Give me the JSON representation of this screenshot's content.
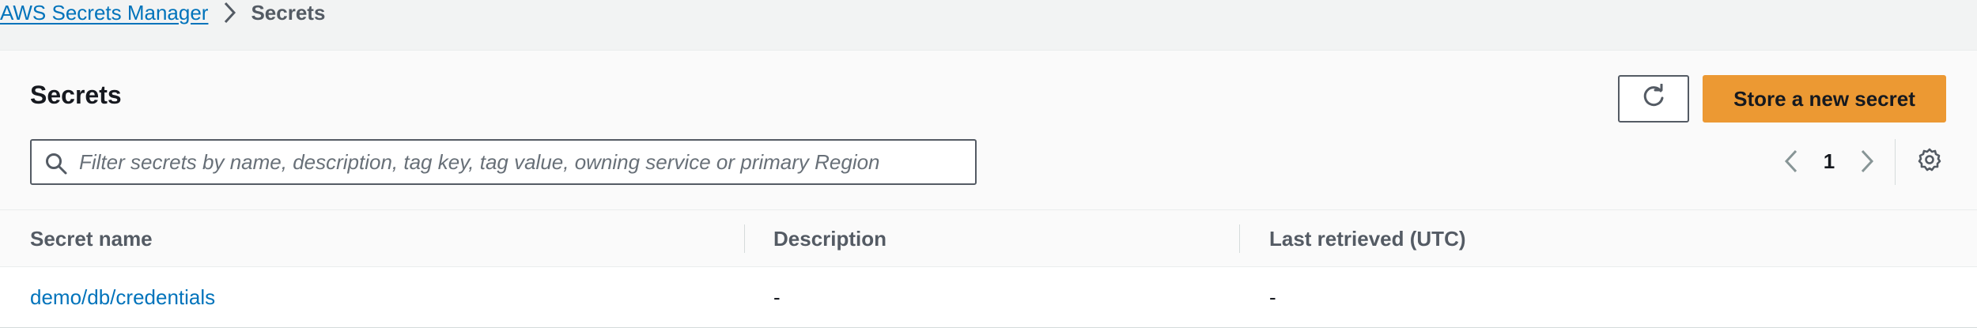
{
  "breadcrumb": {
    "root": "AWS Secrets Manager",
    "current": "Secrets"
  },
  "panel": {
    "title": "Secrets",
    "primary_button": "Store a new secret",
    "refresh_icon": "refresh-icon"
  },
  "search": {
    "placeholder": "Filter secrets by name, description, tag key, tag value, owning service or primary Region",
    "value": ""
  },
  "pagination": {
    "current_page": "1"
  },
  "table": {
    "columns": [
      "Secret name",
      "Description",
      "Last retrieved (UTC)"
    ],
    "rows": [
      {
        "name": "demo/db/credentials",
        "description": "-",
        "last_retrieved": "-"
      }
    ]
  },
  "colors": {
    "accent": "#ec9933",
    "link": "#0073bb"
  }
}
